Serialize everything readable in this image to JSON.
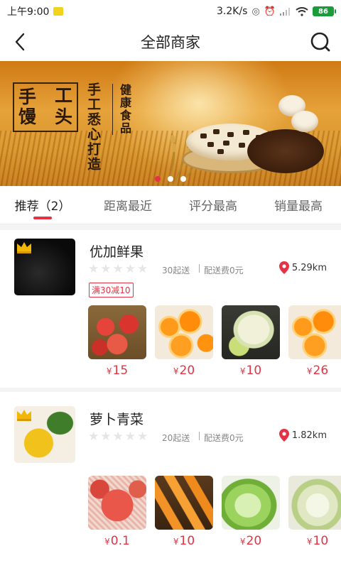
{
  "status_bar": {
    "time": "上午9:00",
    "network_speed": "3.2K/s",
    "battery": "86"
  },
  "header": {
    "title": "全部商家",
    "back_icon": "back-arrow-icon",
    "search_icon": "search-icon"
  },
  "banner": {
    "logo_chars": [
      "手",
      "工",
      "馒",
      "头"
    ],
    "slogan": "手工悉心打造",
    "tagline": "健康食品",
    "page_count": 3,
    "active_page": 1
  },
  "tabs": [
    {
      "label": "推荐（2）",
      "active": true
    },
    {
      "label": "距离最近",
      "active": false
    },
    {
      "label": "评分最高",
      "active": false
    },
    {
      "label": "销量最高",
      "active": false
    }
  ],
  "merchants": [
    {
      "name": "优加鲜果",
      "rating": 0,
      "min_order": "30起送",
      "delivery_fee": "配送费0元",
      "distance": "5.29km",
      "promo": "满30减10",
      "products": [
        {
          "image": "apples",
          "price": "15"
        },
        {
          "image": "orange-slices",
          "price": "20"
        },
        {
          "image": "melon",
          "price": "10"
        },
        {
          "image": "orange-slices",
          "price": "26"
        }
      ]
    },
    {
      "name": "萝卜青菜",
      "rating": 0,
      "min_order": "20起送",
      "delivery_fee": "配送费0元",
      "distance": "1.82km",
      "promo": "",
      "products": [
        {
          "image": "apples-in-net",
          "price": "0.1"
        },
        {
          "image": "cantaloupe-slices",
          "price": "10"
        },
        {
          "image": "lettuce",
          "price": "20"
        },
        {
          "image": "cabbage",
          "price": "10"
        }
      ]
    }
  ],
  "currency_symbol": "¥",
  "colors": {
    "accent": "#e53345",
    "star_empty": "#e6e6e6",
    "text_muted": "#888888"
  }
}
